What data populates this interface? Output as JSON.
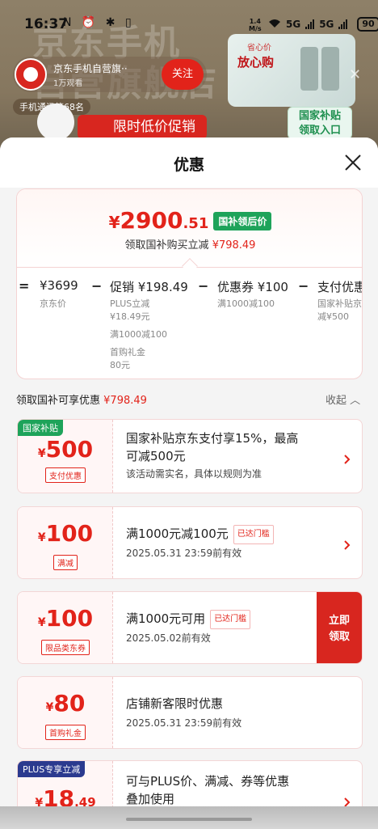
{
  "status_bar": {
    "time": "16:37",
    "left_icons": "N ⏰ ✱ ▯",
    "net_speed_value": "1.4",
    "net_speed_unit": "M/s",
    "signal1": "5G",
    "signal2": "5G",
    "battery": "90"
  },
  "background": {
    "watermark_line1": "京东手机",
    "watermark_line2": "自营旗舰店",
    "store_name": "京东手机自营旗··",
    "store_views": "1万观看",
    "follow_label": "关注",
    "rank_label": "手机通讯第68名",
    "promo_label": "限时低价促销",
    "ad_small": "省心价",
    "ad_big": "放心购",
    "ad_entry_line1": "国家补贴",
    "ad_entry_line2": "领取入口"
  },
  "sheet": {
    "title": "优惠"
  },
  "summary": {
    "price_symbol": "¥",
    "price_int": "2900",
    "price_dec": ".51",
    "price_tag": "国补领后价",
    "sub_prefix": "领取国补购买立减",
    "sub_amount": "¥798.49",
    "calc": {
      "eq": "=",
      "jd_price": "¥3699",
      "jd_price_label": "京东价",
      "minus": "−",
      "promo_main": "促销 ¥198.49",
      "promo_sub1": "PLUS立减",
      "promo_sub2": "¥18.49元",
      "promo_sub3": "满1000减100",
      "promo_sub4": "首购礼金",
      "promo_sub5": "80元",
      "coupon_main": "优惠券 ¥100",
      "coupon_sub": "满1000减100",
      "pay_main": "支付优惠",
      "pay_sub1": "国家补贴京",
      "pay_sub2": "减¥500"
    }
  },
  "section": {
    "prefix": "领取国补可享优惠",
    "amount": "¥798.49",
    "collapse_label": "收起 ︿"
  },
  "coupons": [
    {
      "badge": "国家补贴",
      "badge_color": "#1ea35a",
      "yen": "¥",
      "amount": "500",
      "dec": "",
      "tag": "支付优惠",
      "title_line1": "国家补贴京东支付享15%，最高",
      "title_line2": "可减500元",
      "desc": "该活动需实名，具体以规则为准"
    },
    {
      "yen": "¥",
      "amount": "100",
      "dec": "",
      "tag": "满减",
      "title_line1": "满1000元减100元",
      "status": "已达门槛",
      "desc": "2025.05.31 23:59前有效"
    },
    {
      "yen": "¥",
      "amount": "100",
      "dec": "",
      "tag": "限品类东券",
      "title_line1": "满1000元可用",
      "status": "已达门槛",
      "desc": "2025.05.02前有效",
      "claim_line1": "立即",
      "claim_line2": "领取"
    },
    {
      "yen": "¥",
      "amount": "80",
      "dec": "",
      "tag": "首购礼金",
      "title_line1": "店铺新客限时优惠",
      "desc": "2025.05.31 23:59前有效"
    },
    {
      "badge": "PLUS专享立减",
      "badge_color": "#2b3a8f",
      "yen": "¥",
      "amount": "18",
      "dec": ".49",
      "title_line1": "可与PLUS价、满减、券等优惠",
      "title_line2": "叠加使用"
    }
  ],
  "colors": {
    "accent": "#e2231a",
    "green": "#1ea35a"
  }
}
